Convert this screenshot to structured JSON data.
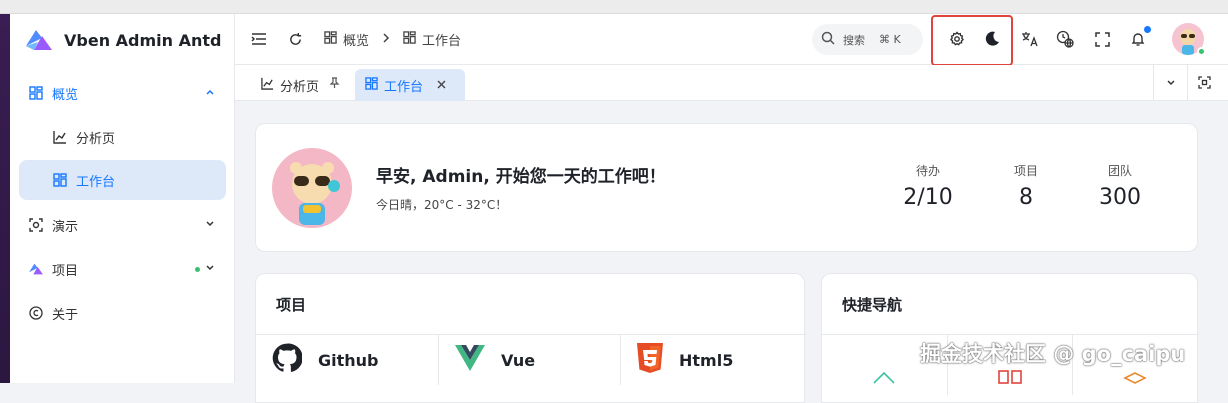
{
  "app": {
    "title": "Vben Admin Antd"
  },
  "sidebar": {
    "items": [
      {
        "label": "概览",
        "icon": "dashboard-icon",
        "expanded": true
      },
      {
        "label": "分析页",
        "icon": "chart-icon"
      },
      {
        "label": "工作台",
        "icon": "dashboard-icon",
        "active": true
      },
      {
        "label": "演示",
        "icon": "scan-icon"
      },
      {
        "label": "项目",
        "icon": "vben-logo-icon"
      },
      {
        "label": "关于",
        "icon": "copyright-icon"
      }
    ]
  },
  "header": {
    "breadcrumb": [
      "概览",
      "工作台"
    ],
    "search": {
      "label": "搜索",
      "shortcut": "⌘ K"
    }
  },
  "tabs": [
    {
      "label": "分析页",
      "pinned": true
    },
    {
      "label": "工作台",
      "active": true
    }
  ],
  "welcome": {
    "greeting": "早安, Admin, 开始您一天的工作吧！",
    "weather": "今日晴，20°C - 32°C！",
    "stats": [
      {
        "label": "待办",
        "value": "2/10"
      },
      {
        "label": "项目",
        "value": "8"
      },
      {
        "label": "团队",
        "value": "300"
      }
    ]
  },
  "projects": {
    "title": "项目",
    "items": [
      {
        "name": "Github",
        "icon": "github-icon"
      },
      {
        "name": "Vue",
        "icon": "vue-icon"
      },
      {
        "name": "Html5",
        "icon": "html5-icon"
      }
    ]
  },
  "quick_nav": {
    "title": "快捷导航"
  },
  "watermark": "掘金技术社区 @ go_caipu",
  "colors": {
    "accent": "#1677ff",
    "active_bg": "#dde8f8",
    "online": "#38c172",
    "highlight_box": "#e0453c"
  }
}
